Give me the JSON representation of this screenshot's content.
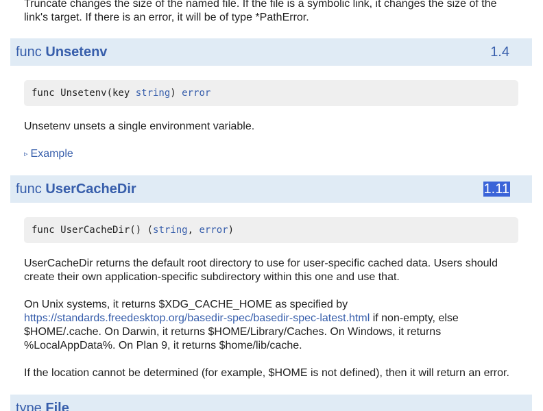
{
  "truncate_desc": {
    "line1": "Truncate changes the size of the named file. If the file is a symbolic link, it changes the size of the",
    "line2": "link's target. If there is an error, it will be of type *PathError."
  },
  "unsetenv": {
    "kw": "func",
    "name": "Unsetenv",
    "version": "1.4",
    "sig_prefix": "func Unsetenv(key ",
    "sig_type1": "string",
    "sig_mid": ") ",
    "sig_type2": "error",
    "desc": "Unsetenv unsets a single environment variable.",
    "example_icon": "▹",
    "example_label": "Example"
  },
  "usercachedir": {
    "kw": "func",
    "name": "UserCacheDir",
    "version": "1.11",
    "sig_prefix": "func UserCacheDir() (",
    "sig_type1": "string",
    "sig_mid": ", ",
    "sig_type2": "error",
    "sig_suffix": ")",
    "desc_p1_line1": "UserCacheDir returns the default root directory to use for user-specific cached data. Users should",
    "desc_p1_line2": "create their own application-specific subdirectory within this one and use that.",
    "desc_p2_line1": "On Unix systems, it returns $XDG_CACHE_HOME as specified by",
    "desc_p2_link": "https://standards.freedesktop.org/basedir-spec/basedir-spec-latest.html",
    "desc_p2_after_link": " if non-empty, else",
    "desc_p2_line3": "$HOME/.cache. On Darwin, it returns $HOME/Library/Caches. On Windows, it returns",
    "desc_p2_line4": "%LocalAppData%. On Plan 9, it returns $home/lib/cache.",
    "desc_p3": "If the location cannot be determined (for example, $HOME is not defined), then it will return an error."
  },
  "type_file": {
    "kw": "type",
    "name": "File"
  },
  "colors": {
    "header_bg": "#e0ebf5",
    "link": "#375eab",
    "code_bg": "#efefef",
    "selection": "#3a63d8"
  }
}
